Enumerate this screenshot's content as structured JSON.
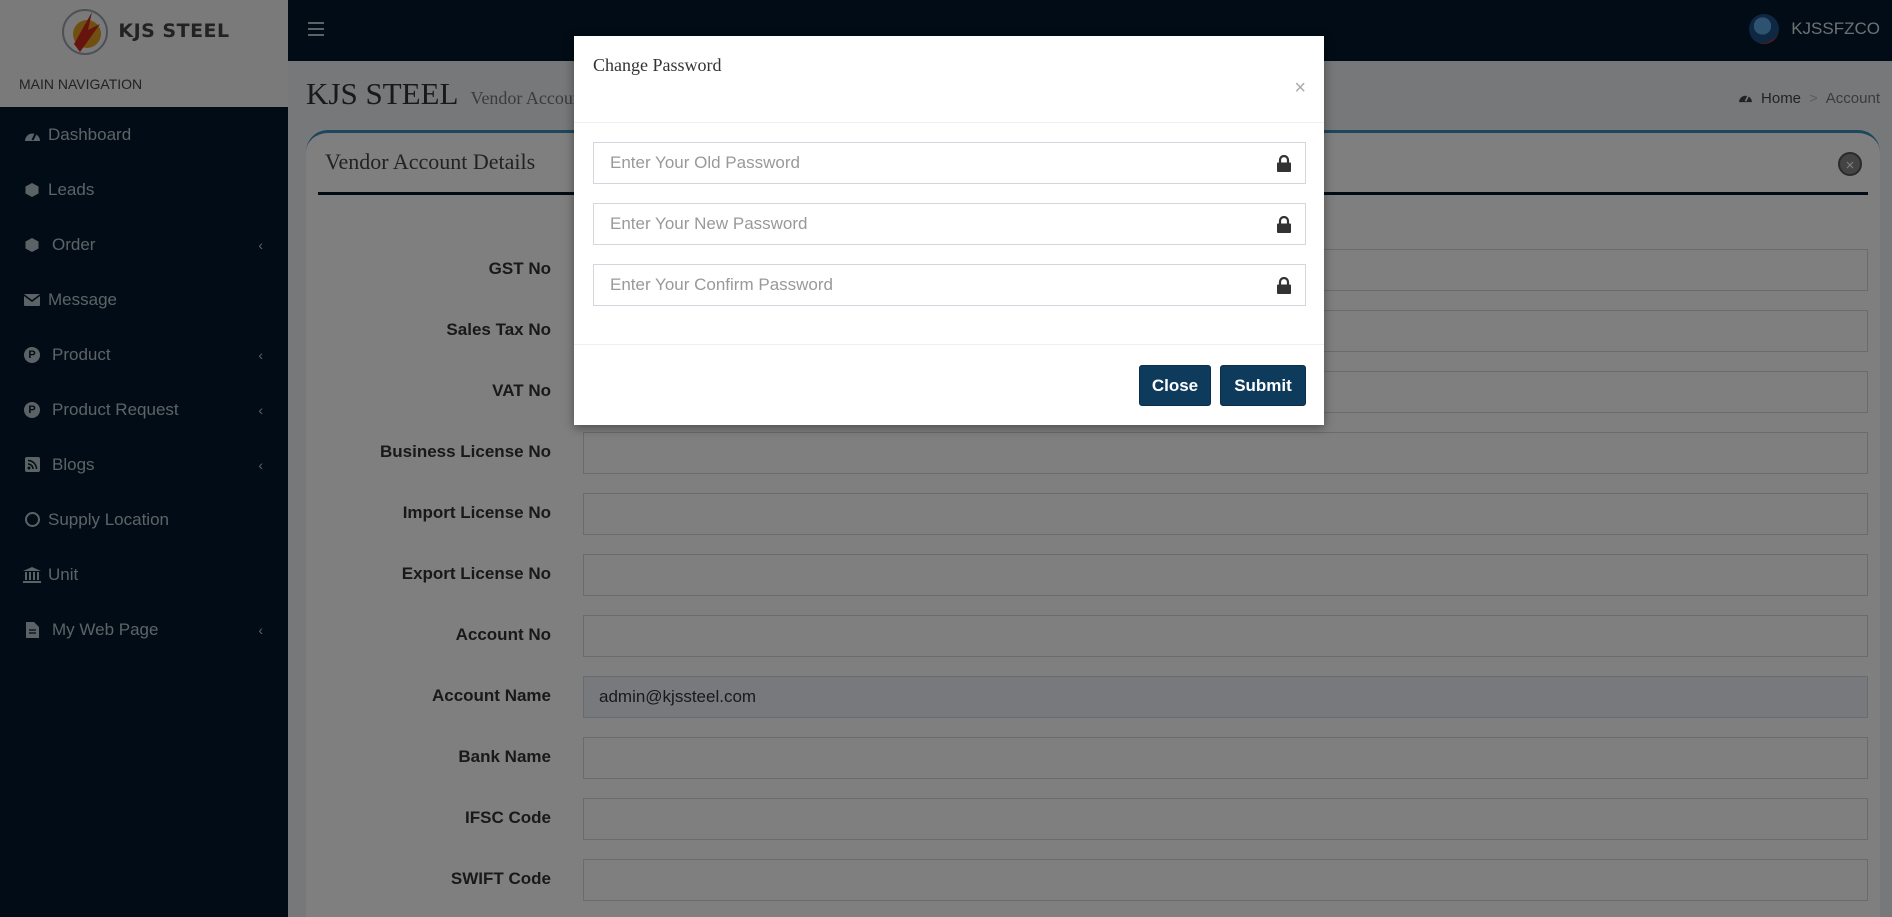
{
  "brand": {
    "logo_text": "KJS STEEL"
  },
  "topbar": {
    "username": "KJSSFZCO"
  },
  "sidebar": {
    "header": "MAIN NAVIGATION",
    "items": [
      {
        "label": "Dashboard",
        "icon": "dashboard-icon"
      },
      {
        "label": "Leads",
        "icon": "leads-icon"
      },
      {
        "label": "Order",
        "icon": "order-icon"
      },
      {
        "label": "Message",
        "icon": "envelope-icon"
      },
      {
        "label": "Product",
        "icon": "product-icon"
      },
      {
        "label": "Product Request",
        "icon": "product-request-icon"
      },
      {
        "label": "Blogs",
        "icon": "rss-icon"
      },
      {
        "label": "Supply Location",
        "icon": "circle-icon"
      },
      {
        "label": "Unit",
        "icon": "bank-icon"
      },
      {
        "label": "My Web Page",
        "icon": "file-icon"
      }
    ]
  },
  "content": {
    "title": "KJS STEEL",
    "subtitle": "Vendor Account",
    "breadcrumb": {
      "home": "Home",
      "current": "Account"
    },
    "box_title": "Vendor Account Details",
    "fields": [
      {
        "label": "GST No",
        "value": ""
      },
      {
        "label": "Sales Tax No",
        "value": ""
      },
      {
        "label": "VAT No",
        "value": ""
      },
      {
        "label": "Business License No",
        "value": ""
      },
      {
        "label": "Import License No",
        "value": ""
      },
      {
        "label": "Export License No",
        "value": ""
      },
      {
        "label": "Account No",
        "value": ""
      },
      {
        "label": "Account Name",
        "value": "admin@kjssteel.com"
      },
      {
        "label": "Bank Name",
        "value": ""
      },
      {
        "label": "IFSC Code",
        "value": ""
      },
      {
        "label": "SWIFT Code",
        "value": ""
      }
    ]
  },
  "modal": {
    "title": "Change Password",
    "close_x": "×",
    "old_placeholder": "Enter Your Old Password",
    "new_placeholder": "Enter Your New Password",
    "confirm_placeholder": "Enter Your Confirm Password",
    "close_label": "Close",
    "submit_label": "Submit"
  }
}
